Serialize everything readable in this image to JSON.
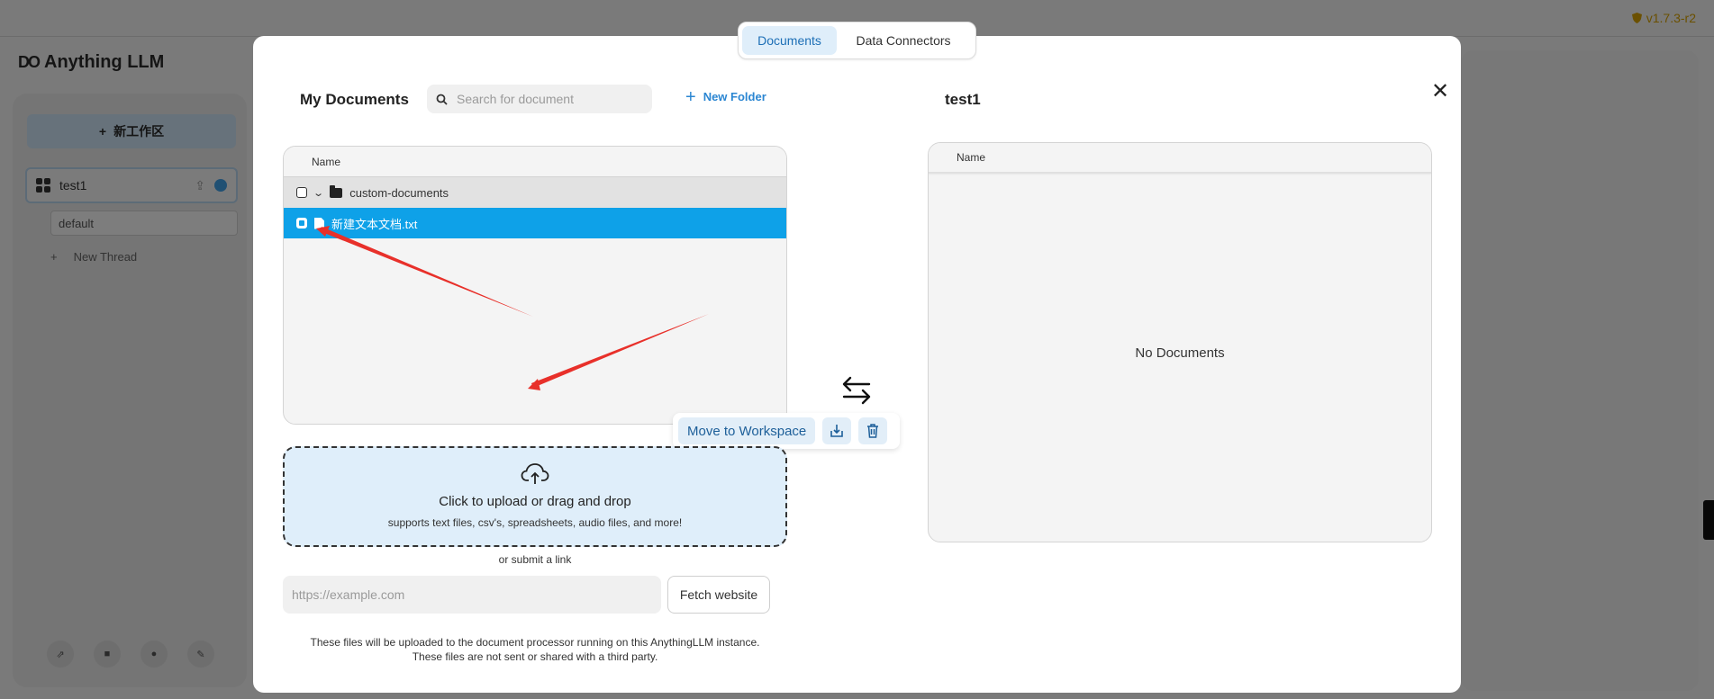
{
  "background_app": {
    "app_name": "Anything LLM",
    "logo_mark": "DO",
    "new_workspace_label": "新工作区",
    "workspace_name": "test1",
    "thread_default": "default",
    "new_thread_label": "New Thread",
    "version": "v1.7.3-r2",
    "footer_buttons": [
      "link-icon",
      "settings-icon",
      "community-icon",
      "wrench-icon"
    ]
  },
  "modal": {
    "tabs": [
      {
        "label": "Documents",
        "active": true
      },
      {
        "label": "Data Connectors",
        "active": false
      }
    ],
    "my_documents": {
      "title": "My Documents",
      "search_placeholder": "Search for document",
      "new_folder_label": "New Folder",
      "column_header": "Name",
      "rows": [
        {
          "type": "folder",
          "name": "custom-documents",
          "expanded": true
        },
        {
          "type": "file",
          "name": "新建文本文档.txt",
          "selected": true
        }
      ],
      "action_bar": {
        "move_label": "Move to Workspace",
        "icons": [
          "save-to-folder-icon",
          "trash-icon"
        ]
      }
    },
    "upload": {
      "title": "Click to upload or drag and drop",
      "subtitle": "supports text files, csv's, spreadsheets, audio files, and more!",
      "or_link": "or submit a link",
      "link_placeholder": "https://example.com",
      "fetch_label": "Fetch website",
      "disclaimer_line1": "These files will be uploaded to the document processor running on this AnythingLLM instance.",
      "disclaimer_line2": "These files are not sent or shared with a third party."
    },
    "workspace_panel": {
      "title": "test1",
      "column_header": "Name",
      "empty_text": "No Documents"
    }
  },
  "colors": {
    "accent": "#0ea1e8",
    "selected_row": "#0ea1e8",
    "upload_bg": "#dfeefa",
    "annotation_arrow": "#e8302a",
    "version": "#d6a000"
  }
}
